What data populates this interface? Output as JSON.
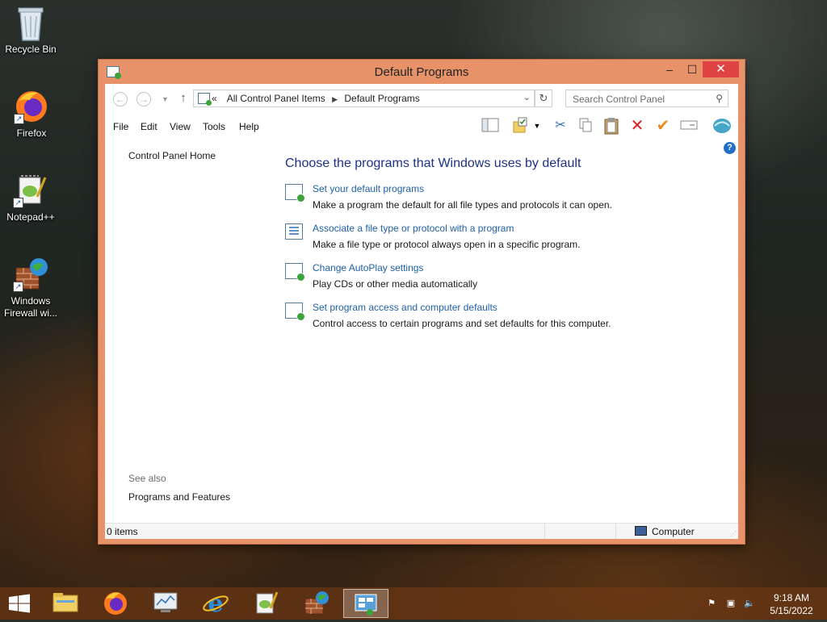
{
  "desktop": {
    "icons": [
      {
        "label": "Recycle Bin",
        "icon": "recycle-bin-icon"
      },
      {
        "label": "Firefox",
        "icon": "firefox-icon"
      },
      {
        "label": "Notepad++",
        "icon": "notepad-plus-plus-icon"
      },
      {
        "label": "Windows Firewall wi...",
        "icon": "windows-firewall-icon"
      }
    ]
  },
  "window": {
    "title": "Default Programs",
    "controls": {
      "minimize": "–",
      "maximize": "☐",
      "close": "✕"
    },
    "address": {
      "overflow": "«",
      "crumbs": [
        "All Control Panel Items",
        "Default Programs"
      ]
    },
    "search": {
      "placeholder": "Search Control Panel"
    },
    "menu": [
      "File",
      "Edit",
      "View",
      "Tools",
      "Help"
    ],
    "left_pane": {
      "home_link": "Control Panel Home",
      "see_also_label": "See also",
      "see_also_links": [
        "Programs and Features"
      ]
    },
    "main": {
      "heading": "Choose the programs that Windows uses by default",
      "tasks": [
        {
          "link": "Set your default programs",
          "desc": "Make a program the default for all file types and protocols it can open.",
          "badge_color": "#3aa33a"
        },
        {
          "link": "Associate a file type or protocol with a program",
          "desc": "Make a file type or protocol always open in a specific program.",
          "badge_color": "#2f6fb8"
        },
        {
          "link": "Change AutoPlay settings",
          "desc": "Play CDs or other media automatically",
          "badge_color": "#3aa33a"
        },
        {
          "link": "Set program access and computer defaults",
          "desc": "Control access to certain programs and set defaults for this computer.",
          "badge_color": "#3aa33a"
        }
      ]
    },
    "status": {
      "items": "0 items",
      "zone": "Computer"
    }
  },
  "taskbar": {
    "apps": [
      "file-explorer-icon",
      "firefox-icon",
      "resource-monitor-icon",
      "internet-explorer-icon",
      "notepad-plus-plus-icon",
      "windows-firewall-icon",
      "control-panel-icon"
    ],
    "clock": {
      "time": "9:18 AM",
      "date": "5/15/2022"
    }
  },
  "colors": {
    "accent": "#e8926a",
    "link": "#1e5fa8",
    "heading": "#1e3287",
    "close": "#e04343"
  }
}
